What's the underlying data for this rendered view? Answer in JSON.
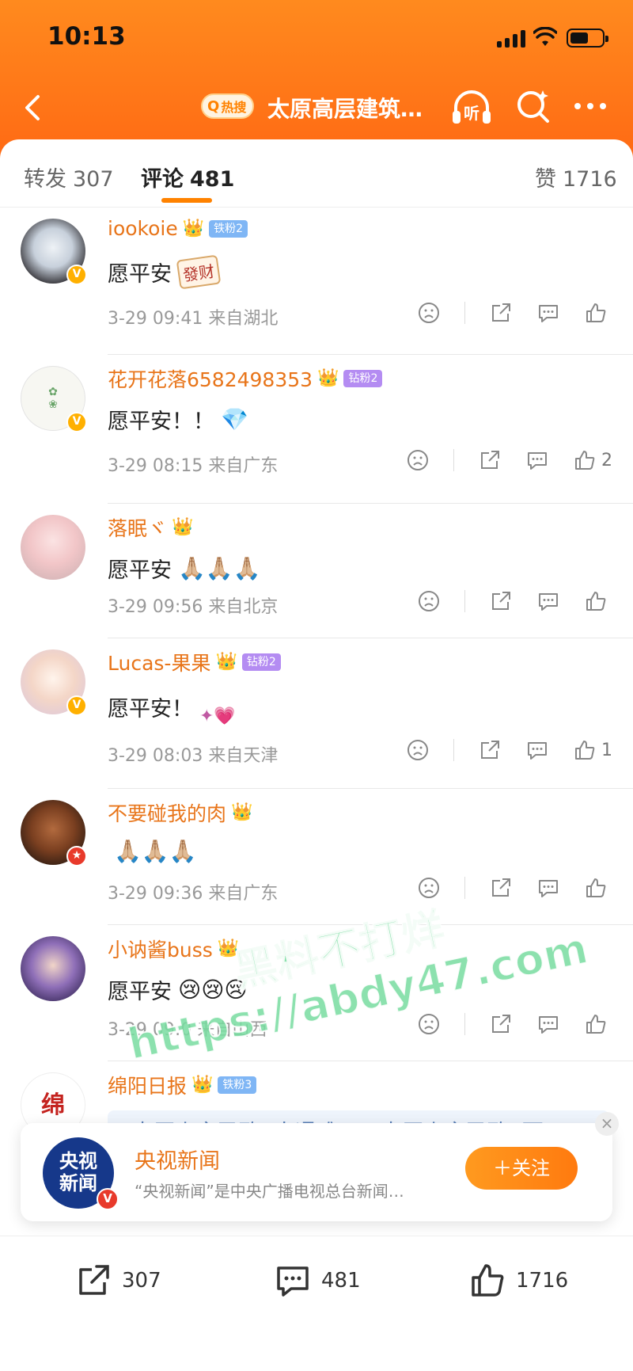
{
  "status": {
    "time": "10:13"
  },
  "nav": {
    "hot_badge": "热搜",
    "title": "太原高层建筑…",
    "listen": "听"
  },
  "tabs": {
    "repost_label": "转发",
    "repost_count": "307",
    "comment_label": "评论",
    "comment_count": "481",
    "like_label": "赞",
    "like_count": "1716"
  },
  "comments": [
    {
      "name": "iookoie",
      "fan_badge": "铁粉2",
      "text": "愿平安",
      "deco": "發财",
      "time": "3-29 09:41",
      "location": "来自湖北",
      "likes": ""
    },
    {
      "name": "花开花落6582498353",
      "fan_badge": "钻粉2",
      "text": "愿平安！！",
      "deco": "💎",
      "time": "3-29 08:15",
      "location": "来自广东",
      "likes": "2"
    },
    {
      "name": "落眠ヾ",
      "fan_badge": "",
      "text": "愿平安",
      "deco": "🙏🏼🙏🏼🙏🏼",
      "time": "3-29 09:56",
      "location": "来自北京",
      "likes": ""
    },
    {
      "name": "Lucas-果果",
      "fan_badge": "钻粉2",
      "text": "愿平安！",
      "deco": "✦💗",
      "time": "3-29 08:03",
      "location": "来自天津",
      "likes": "1"
    },
    {
      "name": "不要碰我的肉",
      "fan_badge": "",
      "text": "",
      "deco": "🙏🏼🙏🏼🙏🏼",
      "time": "3-29 09:36",
      "location": "来自广东",
      "likes": ""
    },
    {
      "name": "小讷酱buss",
      "fan_badge": "",
      "text": "愿平安",
      "deco": "😢😢😢",
      "time": "3-29 09:0",
      "location": "来自山西",
      "likes": ""
    },
    {
      "name": "绵阳日报",
      "fan_badge": "铁粉3",
      "text": "#太原火灾已致3人遇难# #太原火灾已致3死33"
    }
  ],
  "watermark": {
    "line1": "黑料不打烊",
    "line2": "https://abdy47.com"
  },
  "popup": {
    "name": "央视新闻",
    "desc": "“央视新闻”是中央广播电视总台新闻…",
    "follow": "＋关注",
    "logo_l1": "央视",
    "logo_l2": "新闻"
  },
  "bottom": {
    "repost": "307",
    "comment": "481",
    "like": "1716"
  },
  "colors": {
    "brand": "#ff8200",
    "username": "#e8751a",
    "header": "#ff7a18"
  }
}
